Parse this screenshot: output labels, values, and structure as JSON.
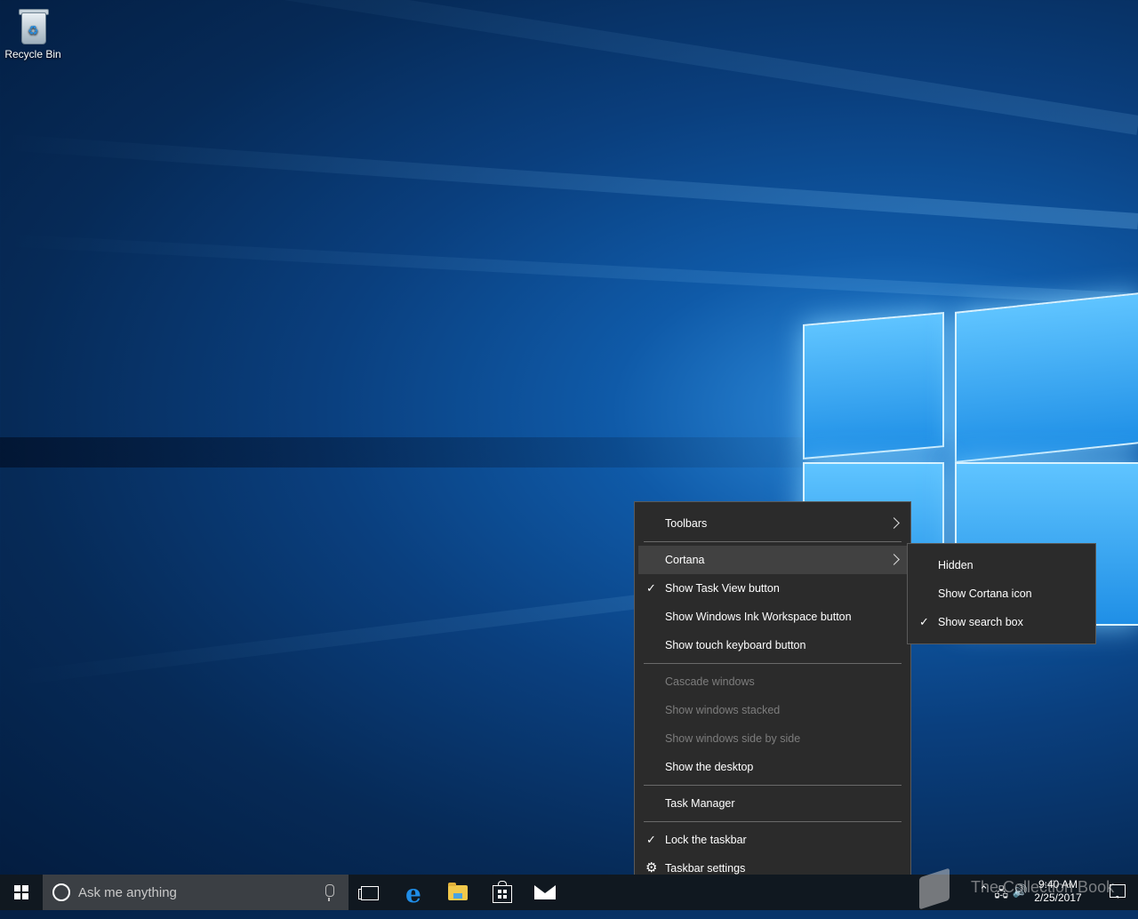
{
  "desktop": {
    "icons": [
      {
        "label": "Recycle Bin",
        "icon": "recycle-bin-icon"
      }
    ]
  },
  "taskbar": {
    "search_placeholder": "Ask me anything",
    "pinned": [
      "task-view-icon",
      "edge-icon",
      "file-explorer-icon",
      "store-icon",
      "mail-icon"
    ],
    "clock": {
      "time": "9:40 AM",
      "date": "2/25/2017"
    }
  },
  "watermark": {
    "text": "The Collection Book"
  },
  "context_menu": {
    "items": [
      {
        "label": "Toolbars",
        "submenu": true
      },
      {
        "label": "Cortana",
        "submenu": true,
        "highlighted": true
      },
      {
        "label": "Show Task View button",
        "checked": true
      },
      {
        "label": "Show Windows Ink Workspace button"
      },
      {
        "label": "Show touch keyboard button"
      },
      {
        "label": "Cascade windows",
        "disabled": true
      },
      {
        "label": "Show windows stacked",
        "disabled": true
      },
      {
        "label": "Show windows side by side",
        "disabled": true
      },
      {
        "label": "Show the desktop"
      },
      {
        "label": "Task Manager"
      },
      {
        "label": "Lock the taskbar",
        "checked": true
      },
      {
        "label": "Taskbar settings",
        "icon": "gear-icon"
      }
    ]
  },
  "cortana_submenu": {
    "items": [
      {
        "label": "Hidden"
      },
      {
        "label": "Show Cortana icon"
      },
      {
        "label": "Show search box",
        "checked": true
      }
    ]
  },
  "colors": {
    "menu_bg": "#2b2b2b",
    "menu_highlight": "#414141",
    "taskbar_bg": "#101820",
    "search_bg": "#3b3f44",
    "accent": "#1f8de8"
  }
}
